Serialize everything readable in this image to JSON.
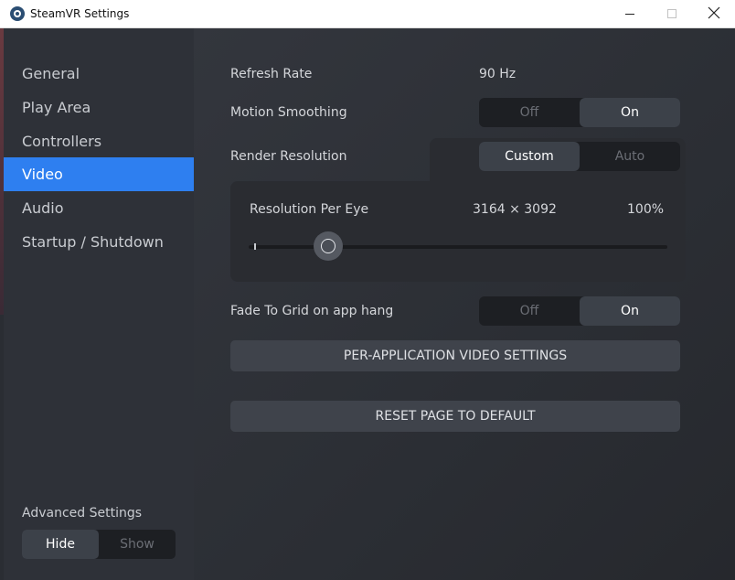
{
  "window": {
    "title": "SteamVR Settings",
    "icon": "steamvr-logo-icon",
    "controls": {
      "minimize": "minimize-icon",
      "maximize": "maximize-icon",
      "close": "close-icon"
    }
  },
  "sidebar": {
    "items": [
      {
        "label": "General",
        "active": false
      },
      {
        "label": "Play Area",
        "active": false
      },
      {
        "label": "Controllers",
        "active": false
      },
      {
        "label": "Video",
        "active": true
      },
      {
        "label": "Audio",
        "active": false
      },
      {
        "label": "Startup / Shutdown",
        "active": false
      }
    ],
    "advanced": {
      "label": "Advanced Settings",
      "options": [
        "Hide",
        "Show"
      ],
      "selected": "Hide"
    }
  },
  "video": {
    "refresh_rate": {
      "label": "Refresh Rate",
      "value": "90 Hz"
    },
    "motion_smoothing": {
      "label": "Motion Smoothing",
      "options": [
        "Off",
        "On"
      ],
      "selected": "On"
    },
    "render_resolution": {
      "label": "Render Resolution",
      "options": [
        "Custom",
        "Auto"
      ],
      "selected": "Custom"
    },
    "resolution_per_eye": {
      "label": "Resolution Per Eye",
      "resolution": "3164 × 3092",
      "percent": "100%"
    },
    "fade_to_grid": {
      "label": "Fade To Grid on app hang",
      "options": [
        "Off",
        "On"
      ],
      "selected": "On"
    },
    "per_app_button": "PER-APPLICATION VIDEO SETTINGS",
    "reset_button": "RESET PAGE TO DEFAULT"
  },
  "colors": {
    "accent": "#2e7ff0",
    "background": "#2a2d33",
    "sidebar": "#2e3138"
  }
}
